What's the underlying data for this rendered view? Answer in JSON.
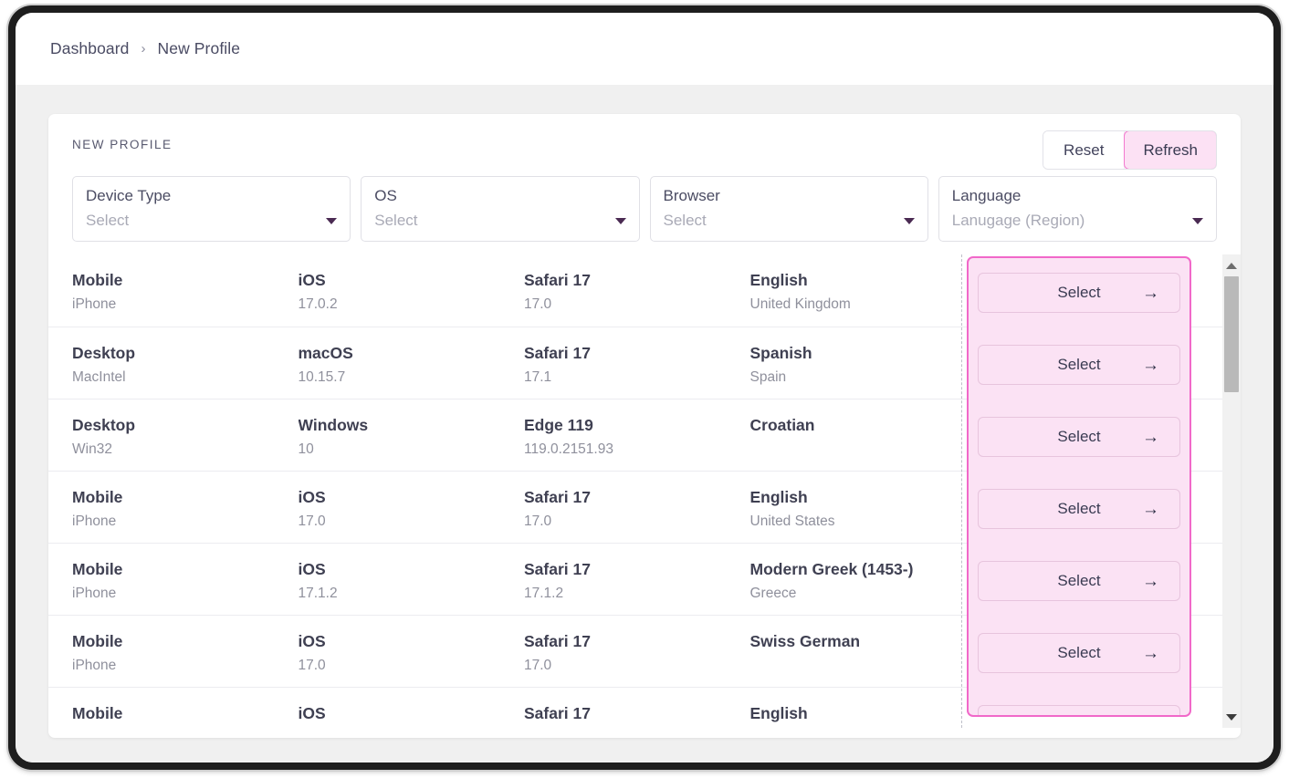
{
  "breadcrumb": {
    "items": [
      {
        "label": "Dashboard"
      },
      {
        "label": "New Profile"
      }
    ],
    "separator": "›"
  },
  "card": {
    "title": "NEW PROFILE",
    "actions": {
      "reset_label": "Reset",
      "refresh_label": "Refresh"
    },
    "filters": [
      {
        "label": "Device Type",
        "value": "Select",
        "placeholder": "Select"
      },
      {
        "label": "OS",
        "value": "Select",
        "placeholder": "Select"
      },
      {
        "label": "Browser",
        "value": "Select",
        "placeholder": "Select"
      },
      {
        "label": "Language",
        "value": "Lanugage (Region)",
        "placeholder": "Lanugage (Region)"
      }
    ],
    "action_button_label": "Select",
    "action_button_icon": "arrow-right-icon",
    "rows": [
      {
        "device": "Mobile",
        "device_detail": "iPhone",
        "os": "iOS",
        "os_detail": "17.0.2",
        "browser": "Safari 17",
        "browser_detail": "17.0",
        "language": "English",
        "language_detail": "United Kingdom"
      },
      {
        "device": "Desktop",
        "device_detail": "MacIntel",
        "os": "macOS",
        "os_detail": "10.15.7",
        "browser": "Safari 17",
        "browser_detail": "17.1",
        "language": "Spanish",
        "language_detail": "Spain"
      },
      {
        "device": "Desktop",
        "device_detail": "Win32",
        "os": "Windows",
        "os_detail": "10",
        "browser": "Edge 119",
        "browser_detail": "119.0.2151.93",
        "language": "Croatian",
        "language_detail": ""
      },
      {
        "device": "Mobile",
        "device_detail": "iPhone",
        "os": "iOS",
        "os_detail": "17.0",
        "browser": "Safari 17",
        "browser_detail": "17.0",
        "language": "English",
        "language_detail": "United States"
      },
      {
        "device": "Mobile",
        "device_detail": "iPhone",
        "os": "iOS",
        "os_detail": "17.1.2",
        "browser": "Safari 17",
        "browser_detail": "17.1.2",
        "language": "Modern Greek (1453-)",
        "language_detail": "Greece"
      },
      {
        "device": "Mobile",
        "device_detail": "iPhone",
        "os": "iOS",
        "os_detail": "17.0",
        "browser": "Safari 17",
        "browser_detail": "17.0",
        "language": "Swiss German",
        "language_detail": ""
      },
      {
        "device": "Mobile",
        "device_detail": "",
        "os": "iOS",
        "os_detail": "",
        "browser": "Safari 17",
        "browser_detail": "",
        "language": "English",
        "language_detail": ""
      }
    ]
  },
  "colors": {
    "accent_pink": "#f168c9",
    "panel_pink": "#fbe2f4",
    "refresh_pink_fill": "#fce1f4",
    "page_background": "#f0f0f0",
    "text_primary": "#3f4052",
    "text_secondary": "#8f909c",
    "frame": "#1e1e1e"
  }
}
